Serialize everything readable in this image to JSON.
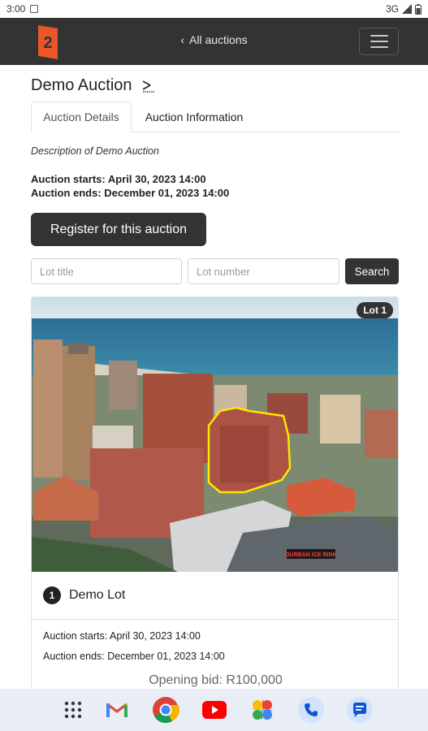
{
  "status_bar": {
    "time": "3:00",
    "network": "3G"
  },
  "nav": {
    "back_label": "All auctions",
    "logo_text": "2"
  },
  "auction": {
    "title": "Demo Auction",
    "description": "Description of Demo Auction",
    "starts": "Auction starts: April 30, 2023 14:00",
    "ends": "Auction ends: December 01, 2023 14:00",
    "register_label": "Register for this auction"
  },
  "tabs": [
    {
      "label": "Auction Details",
      "active": true
    },
    {
      "label": "Auction Information",
      "active": false
    }
  ],
  "search": {
    "lot_title_placeholder": "Lot title",
    "lot_number_placeholder": "Lot number",
    "button_label": "Search"
  },
  "lot": {
    "badge": "Lot 1",
    "number": "1",
    "name": "Demo Lot",
    "starts": "Auction starts: April 30, 2023 14:00",
    "ends": "Auction ends: December 01, 2023 14:00",
    "opening_bid": "Opening bid: R100,000",
    "image_caption": "DURBAN ICE RINK"
  },
  "dock": [
    "app-drawer",
    "gmail",
    "chrome",
    "youtube",
    "photos",
    "phone",
    "messages"
  ],
  "colors": {
    "navbar": "#333333",
    "accent": "#e8562a",
    "button": "#333333",
    "highlight": "#ffe600"
  }
}
